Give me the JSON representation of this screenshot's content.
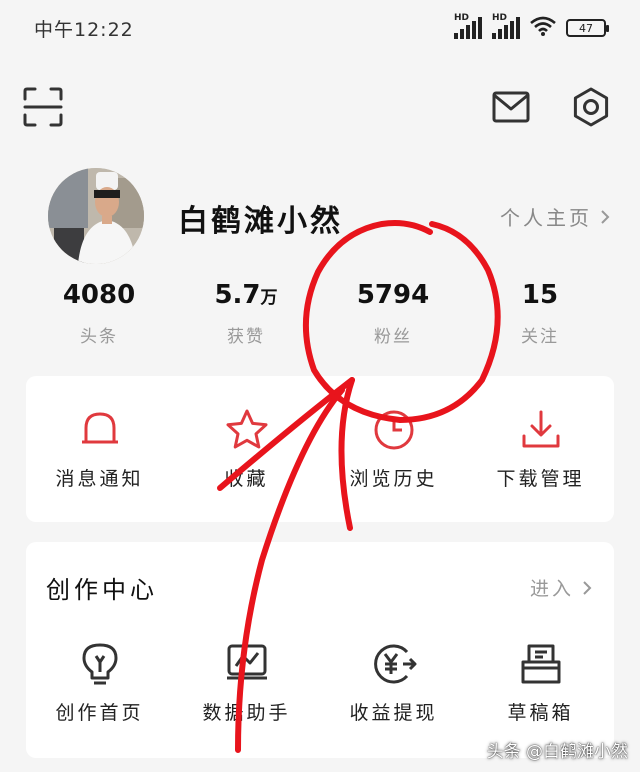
{
  "status_bar": {
    "time": "中午12:22",
    "hd_label_1": "HD",
    "hd_label_2": "HD",
    "battery": "47"
  },
  "top_bar": {
    "icons": [
      "scan-icon",
      "mail-icon",
      "settings-icon"
    ]
  },
  "profile": {
    "username": "白鹤滩小然",
    "homepage_label": "个人主页"
  },
  "stats": [
    {
      "value": "4080",
      "unit": "",
      "label": "头条"
    },
    {
      "value": "5.7",
      "unit": "万",
      "label": "获赞"
    },
    {
      "value": "5794",
      "unit": "",
      "label": "粉丝"
    },
    {
      "value": "15",
      "unit": "",
      "label": "关注"
    }
  ],
  "quick_actions": [
    {
      "label": "消息通知",
      "icon": "bell-icon"
    },
    {
      "label": "收藏",
      "icon": "star-icon"
    },
    {
      "label": "浏览历史",
      "icon": "clock-icon"
    },
    {
      "label": "下载管理",
      "icon": "download-icon"
    }
  ],
  "creation_center": {
    "title": "创作中心",
    "enter_label": "进入",
    "items": [
      {
        "label": "创作首页",
        "icon": "lightbulb-icon"
      },
      {
        "label": "数据助手",
        "icon": "chart-icon"
      },
      {
        "label": "收益提现",
        "icon": "yuan-icon"
      },
      {
        "label": "草稿箱",
        "icon": "drafts-icon"
      }
    ]
  },
  "colors": {
    "accent": "#e0393e",
    "annotation": "#e8141c",
    "background": "#f5f5f5"
  },
  "watermark": "头条 @白鹤滩小然"
}
